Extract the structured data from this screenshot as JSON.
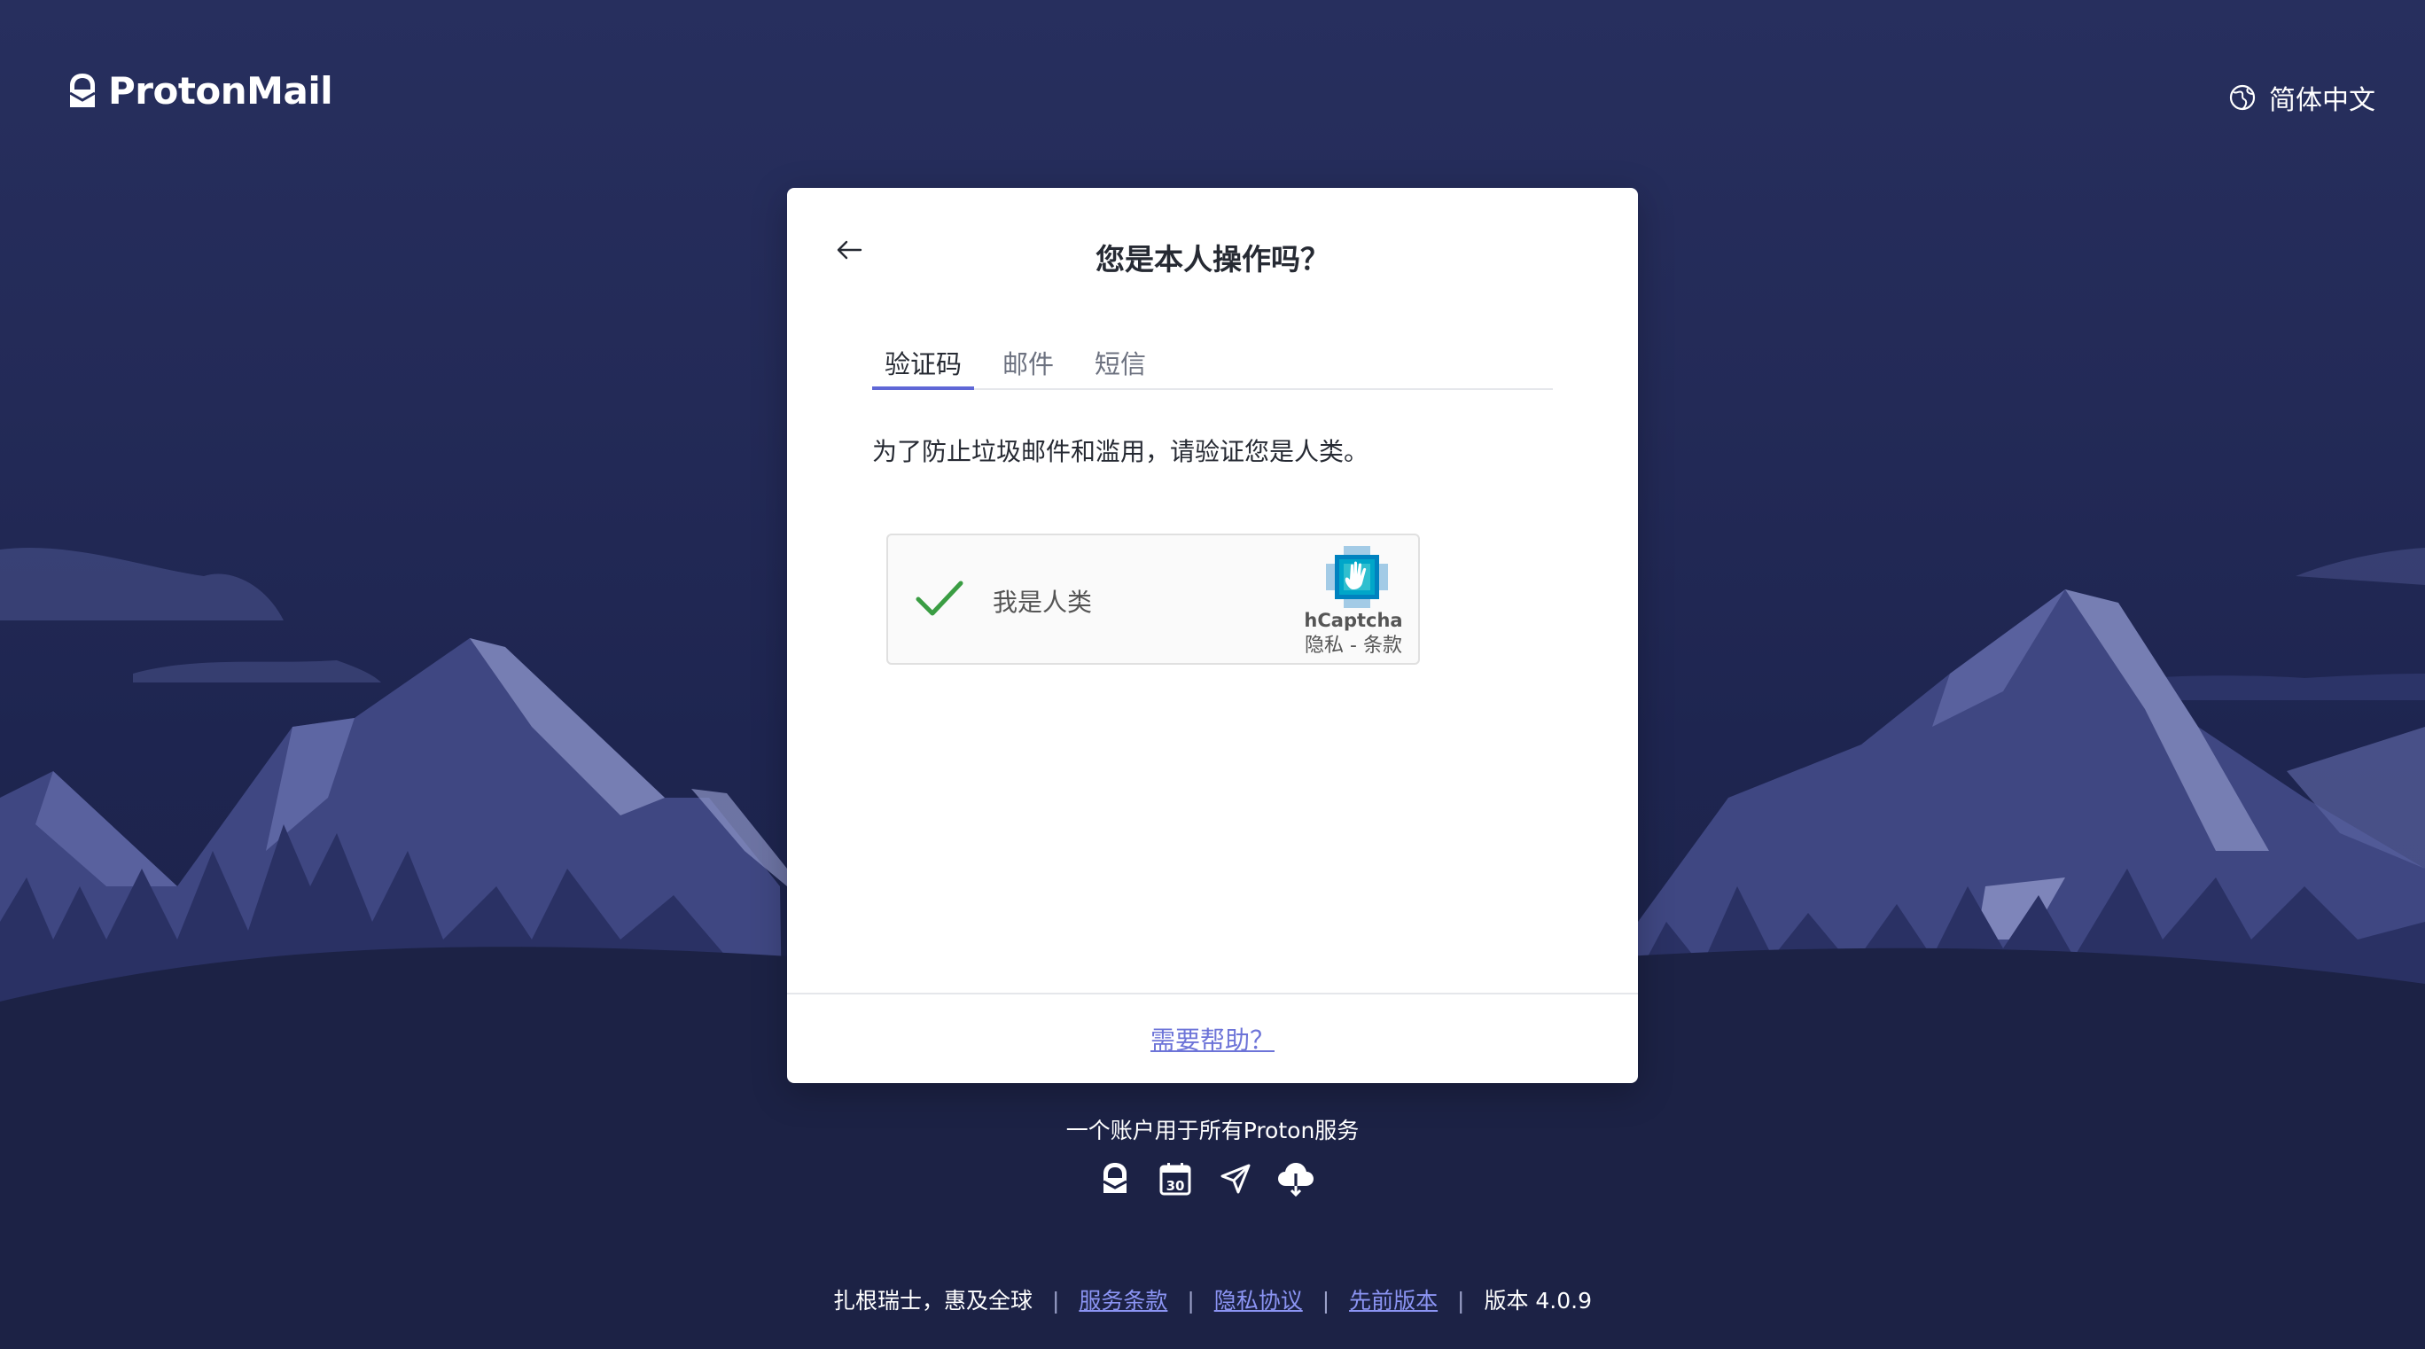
{
  "header": {
    "logo_text": "ProtonMail",
    "language": "简体中文"
  },
  "card": {
    "title": "您是本人操作吗？",
    "tabs": [
      {
        "label": "验证码",
        "active": true
      },
      {
        "label": "邮件",
        "active": false
      },
      {
        "label": "短信",
        "active": false
      }
    ],
    "description": "为了防止垃圾邮件和滥用，请验证您是人类。",
    "captcha": {
      "label": "我是人类",
      "checked": true,
      "brand": "hCaptcha",
      "privacy": "隐私",
      "separator": " - ",
      "terms": "条款"
    },
    "help_link": "需要帮助？"
  },
  "services": {
    "text": "一个账户用于所有Proton服务",
    "icons": [
      "protonmail-icon",
      "calendar-icon",
      "vpn-icon",
      "drive-icon"
    ],
    "calendar_day": "30"
  },
  "footer": {
    "slogan": "扎根瑞士，惠及全球",
    "terms": "服务条款",
    "privacy": "隐私协议",
    "previous_version": "先前版本",
    "version": "版本 4.0.9",
    "separator": "|"
  },
  "colors": {
    "background": "#232a57",
    "accent": "#5f67d6",
    "link": "#8b94f3",
    "check": "#3a9d43"
  }
}
